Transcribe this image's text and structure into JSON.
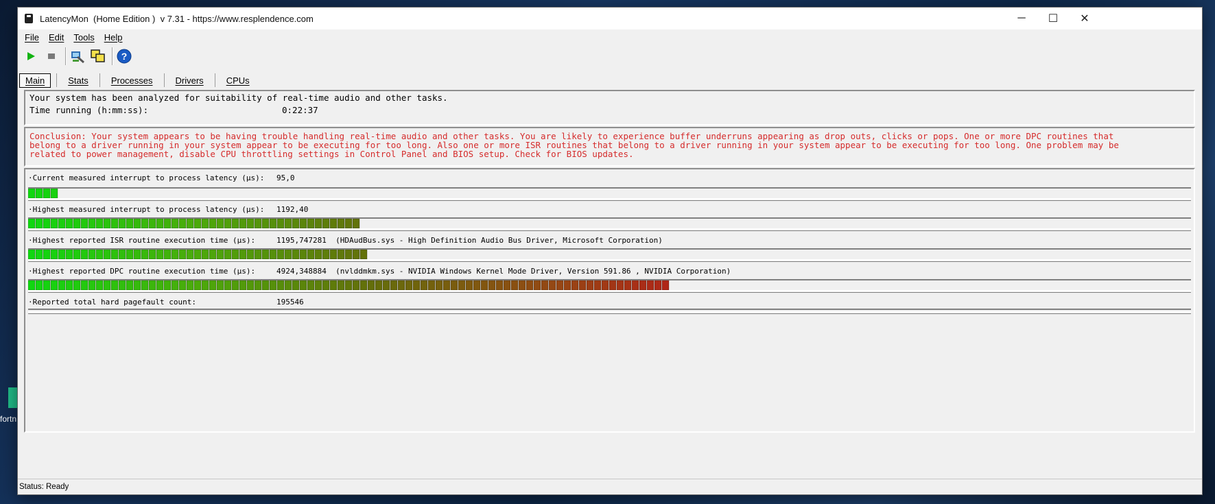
{
  "desktop": {
    "icon_label": "fortn"
  },
  "window": {
    "title": "LatencyMon  (Home Edition )  v 7.31 - https://www.resplendence.com",
    "controls": {
      "minimize": "─",
      "maximize": "☐",
      "close": "✕"
    }
  },
  "menu": {
    "file": "File",
    "edit": "Edit",
    "tools": "Tools",
    "help": "Help"
  },
  "toolbar": {
    "icons": [
      "play-icon",
      "stop-icon",
      "inspect-icon",
      "copy-windows-icon",
      "help-icon"
    ],
    "play_color": "#13b313",
    "stop_color": "#7a7a7a",
    "help_color": "#1a5bc4"
  },
  "tabs": [
    "Main",
    "Stats",
    "Processes",
    "Drivers",
    "CPUs"
  ],
  "summary": {
    "line1": "Your system has been analyzed for suitability of real-time audio and other tasks.",
    "time_label": "Time running (h:mm:ss):",
    "time_value": "0:22:37"
  },
  "conclusion": {
    "color": "#d52b2b",
    "line1": "Conclusion: Your system appears to be having trouble handling real-time audio and other tasks. You are likely to experience buffer underruns appearing as drop outs, clicks or pops. One or more DPC routines that",
    "line2": "belong to a driver running in your system appear to be executing for too long. Also one or more ISR routines that belong to a driver running in your system appear to be executing for too long. One problem may be",
    "line3": "related to power management, disable CPU throttling settings in Control Panel and BIOS setup. Check for BIOS updates."
  },
  "metrics": [
    {
      "label": "·Current measured interrupt to process latency (µs):",
      "value": "95,0",
      "bar_blocks": 4
    },
    {
      "label": "·Highest measured interrupt to process latency (µs):",
      "value": "1192,40",
      "bar_blocks": 44
    },
    {
      "label": "·Highest reported ISR routine execution time (µs):",
      "value": "1195,747281  (HDAudBus.sys - High Definition Audio Bus Driver, Microsoft Corporation)",
      "bar_blocks": 45
    },
    {
      "label": "·Highest reported DPC routine execution time (µs):",
      "value": "4924,348884  (nvlddmkm.sys - NVIDIA Windows Kernel Mode Driver, Version 591.86 , NVIDIA Corporation)",
      "bar_blocks": 85
    },
    {
      "label": "·Reported total hard pagefault count:",
      "value": "195546",
      "bar_blocks": 0
    }
  ],
  "status": "Status: Ready"
}
